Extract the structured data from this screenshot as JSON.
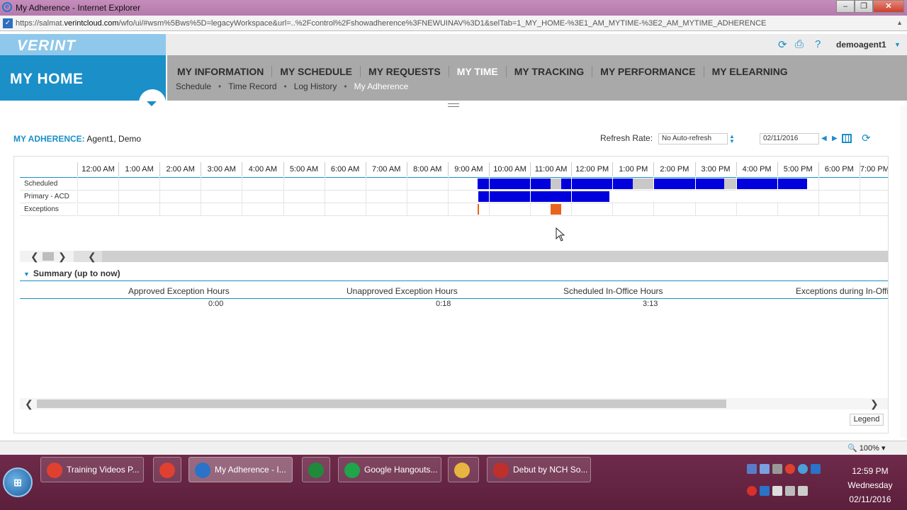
{
  "browser": {
    "window_title": "My Adherence - Internet Explorer",
    "url_prefix": "https://salmat.",
    "url_domain": "verintcloud.com",
    "url_rest": "/wfo/ui/#wsm%5Bws%5D=legacyWorkspace&url=..%2Fcontrol%2Fshowadherence%3FNEWUINAV%3D1&selTab=1_MY_HOME-%3E1_AM_MYTIME-%3E2_AM_MYTIME_ADHERENCE",
    "zoom": "100%"
  },
  "brand": {
    "logo": "VERINT",
    "section_title": "MY HOME",
    "username": "demoagent1"
  },
  "nav": {
    "main": [
      {
        "label": "MY INFORMATION",
        "active": false
      },
      {
        "label": "MY SCHEDULE",
        "active": false
      },
      {
        "label": "MY REQUESTS",
        "active": false
      },
      {
        "label": "MY TIME",
        "active": true
      },
      {
        "label": "MY TRACKING",
        "active": false
      },
      {
        "label": "MY PERFORMANCE",
        "active": false
      },
      {
        "label": "MY ELEARNING",
        "active": false
      }
    ],
    "sub": [
      {
        "label": "Schedule",
        "active": false
      },
      {
        "label": "Time Record",
        "active": false
      },
      {
        "label": "Log History",
        "active": false
      },
      {
        "label": "My Adherence",
        "active": true
      }
    ]
  },
  "adherence": {
    "title_label": "MY ADHERENCE:",
    "agent": "Agent1, Demo",
    "refresh_label": "Refresh Rate:",
    "refresh_value": "No Auto-refresh",
    "date": "02/11/2016"
  },
  "timeline": {
    "hours": [
      "12:00 AM",
      "1:00 AM",
      "2:00 AM",
      "3:00 AM",
      "4:00 AM",
      "5:00 AM",
      "6:00 AM",
      "7:00 AM",
      "8:00 AM",
      "9:00 AM",
      "10:00 AM",
      "11:00 AM",
      "12:00 PM",
      "1:00 PM",
      "2:00 PM",
      "3:00 PM",
      "4:00 PM",
      "5:00 PM",
      "6:00 PM",
      "7:00 PM"
    ],
    "rows": [
      {
        "label": "Scheduled",
        "segments": [
          {
            "start": 9.72,
            "end": 11.5,
            "color": "#0000dd"
          },
          {
            "start": 11.5,
            "end": 11.75,
            "color": "#c8c8c8"
          },
          {
            "start": 11.75,
            "end": 13.5,
            "color": "#0000dd"
          },
          {
            "start": 13.5,
            "end": 14.0,
            "color": "#c8c8c8"
          },
          {
            "start": 14.0,
            "end": 15.72,
            "color": "#0000dd"
          },
          {
            "start": 15.72,
            "end": 16.0,
            "color": "#c8c8c8"
          },
          {
            "start": 16.0,
            "end": 17.72,
            "color": "#0000dd"
          }
        ]
      },
      {
        "label": "Primary - ACD",
        "segments": [
          {
            "start": 9.75,
            "end": 12.92,
            "color": "#0000dd"
          }
        ]
      },
      {
        "label": "Exceptions",
        "segments": [
          {
            "start": 9.72,
            "end": 9.75,
            "color": "#e8641e"
          },
          {
            "start": 11.5,
            "end": 11.75,
            "color": "#e8641e"
          }
        ]
      }
    ]
  },
  "summary": {
    "heading": "Summary (up to now)",
    "columns": [
      {
        "label": "Approved Exception Hours",
        "value": "0:00"
      },
      {
        "label": "Unapproved Exception Hours",
        "value": "0:18"
      },
      {
        "label": "Scheduled In-Office Hours",
        "value": "3:13"
      },
      {
        "label": "Exceptions during In-Offic",
        "value": ""
      }
    ]
  },
  "legend_label": "Legend",
  "taskbar": {
    "tasks": [
      {
        "label": "Training Videos P...",
        "icon_color": "#e04030",
        "active": false
      },
      {
        "label": "",
        "icon_color": "#e04030",
        "active": false
      },
      {
        "label": "My Adherence - I...",
        "icon_color": "#2a73c8",
        "active": true
      },
      {
        "label": "",
        "icon_color": "#1f8a3c",
        "active": false
      },
      {
        "label": "Google Hangouts...",
        "icon_color": "#1fa54a",
        "active": false
      },
      {
        "label": "",
        "icon_color": "#e8b640",
        "active": false
      },
      {
        "label": "Debut by NCH So...",
        "icon_color": "#c0302a",
        "active": false
      }
    ],
    "clock_time": "12:59 PM",
    "clock_day": "Wednesday",
    "clock_date": "02/11/2016"
  }
}
